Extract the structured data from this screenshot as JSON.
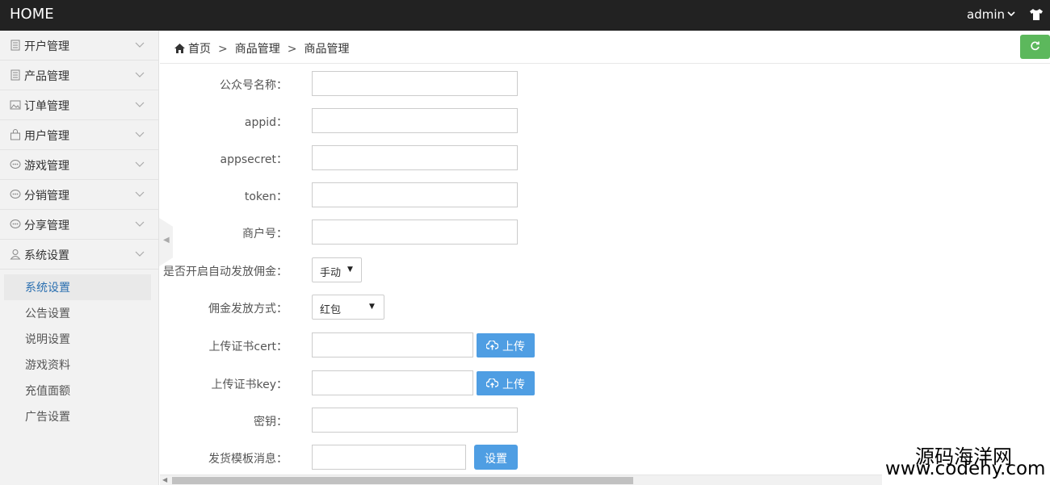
{
  "topbar": {
    "brand": "HOME",
    "user": "admin",
    "user_caret": "⌵",
    "shirt_icon": "shirt-icon"
  },
  "sidebar": {
    "menus": [
      {
        "label": "开户管理",
        "icon": "book-icon"
      },
      {
        "label": "产品管理",
        "icon": "book-icon"
      },
      {
        "label": "订单管理",
        "icon": "picture-icon"
      },
      {
        "label": "用户管理",
        "icon": "bag-icon"
      },
      {
        "label": "游戏管理",
        "icon": "chat-icon"
      },
      {
        "label": "分销管理",
        "icon": "chat-icon"
      },
      {
        "label": "分享管理",
        "icon": "chat-icon"
      },
      {
        "label": "系统设置",
        "icon": "user-icon"
      }
    ],
    "submenu": [
      {
        "label": "系统设置",
        "active": true
      },
      {
        "label": "公告设置",
        "active": false
      },
      {
        "label": "说明设置",
        "active": false
      },
      {
        "label": "游戏资料",
        "active": false
      },
      {
        "label": "充值面额",
        "active": false
      },
      {
        "label": "广告设置",
        "active": false
      }
    ],
    "collapse_glyph": "◀"
  },
  "breadcrumb": {
    "home": "首页",
    "sep": ">",
    "level1": "商品管理",
    "level2": "商品管理"
  },
  "form": {
    "wechat_name_label": "公众号名称：",
    "appid_label": "appid：",
    "appsecret_label": "appsecret：",
    "token_label": "token：",
    "merchant_label": "商户号：",
    "auto_commission_label": "是否开启自动发放佣金：",
    "auto_commission_value": "手动",
    "commission_method_label": "佣金发放方式：",
    "commission_method_value": "红包",
    "cert_label": "上传证书cert：",
    "key_label": "上传证书key：",
    "secret_label": "密钥：",
    "template_label": "发货模板消息：",
    "upload_label": "上传",
    "set_label": "设置",
    "select_arrow": "▼"
  },
  "scrollbar": {
    "left_arrow": "◀"
  },
  "watermark": {
    "line1": "源码海洋网",
    "line2": "www.codehy.com"
  },
  "colors": {
    "topbar": "#222222",
    "sidebar": "#f2f2f2",
    "active_link": "#2a6fb0",
    "primary_button": "#4f9ee3",
    "refresh_button": "#5cb85c"
  }
}
